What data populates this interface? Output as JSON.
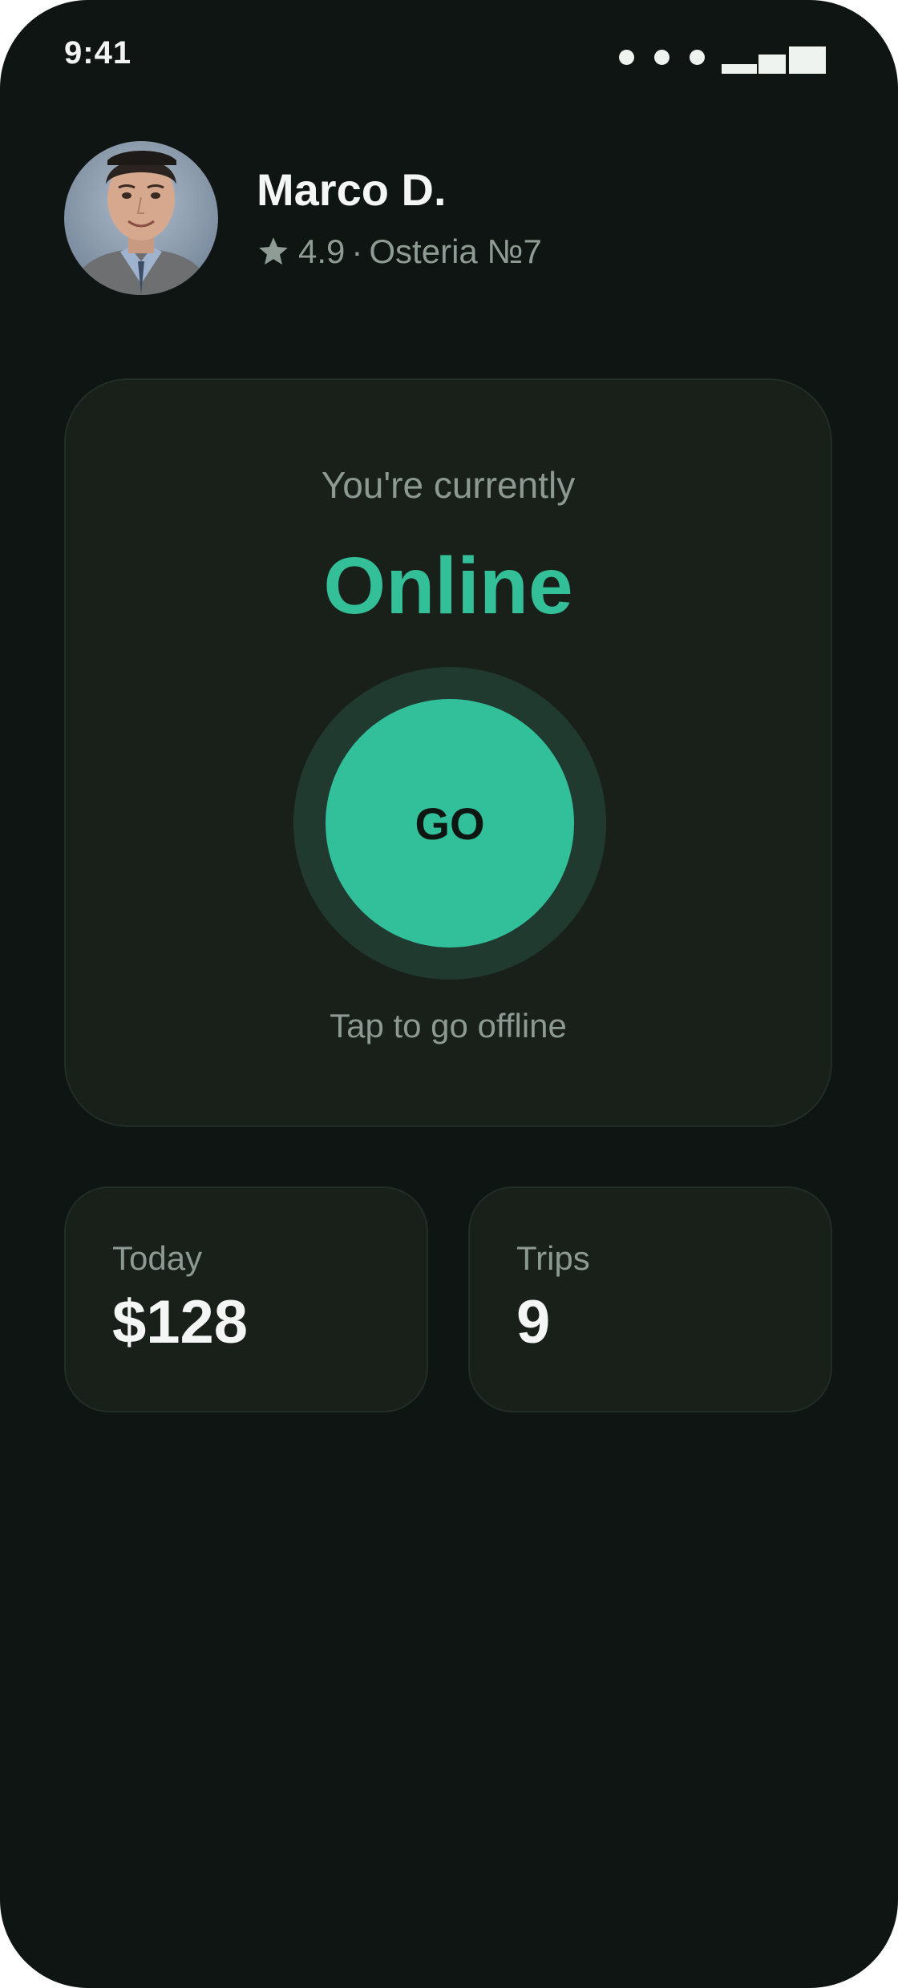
{
  "status_bar": {
    "time": "9:41"
  },
  "profile": {
    "name": "Marco D.",
    "rating": "4.9",
    "separator": "·",
    "venue": "Osteria №7"
  },
  "status_card": {
    "label": "You're currently",
    "status": "Online",
    "button_label": "GO",
    "hint": "Tap to go offline"
  },
  "stats": [
    {
      "label": "Today",
      "value": "$128"
    },
    {
      "label": "Trips",
      "value": "9"
    }
  ],
  "icons": {
    "rating": "star-icon",
    "signal": "signal-icon",
    "status_dots": "dots-icon"
  },
  "colors": {
    "background": "#0f1513",
    "card": "#182019",
    "accent": "#31c099",
    "ring": "#213a30",
    "muted_text": "#8d9993"
  }
}
